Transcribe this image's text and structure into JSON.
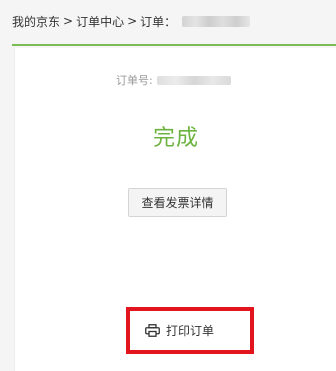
{
  "breadcrumb": {
    "home": "我的京东",
    "separator": ">",
    "order_center": "订单中心",
    "current_label": "订单："
  },
  "order": {
    "number_label": "订单号:",
    "status": "完成"
  },
  "actions": {
    "view_invoice": "查看发票详情",
    "print_order": "打印订单"
  },
  "colors": {
    "accent_green": "#7abd54",
    "status_green": "#6cb33f",
    "highlight_red": "#e2141d"
  },
  "icons": {
    "print": "printer-icon"
  }
}
